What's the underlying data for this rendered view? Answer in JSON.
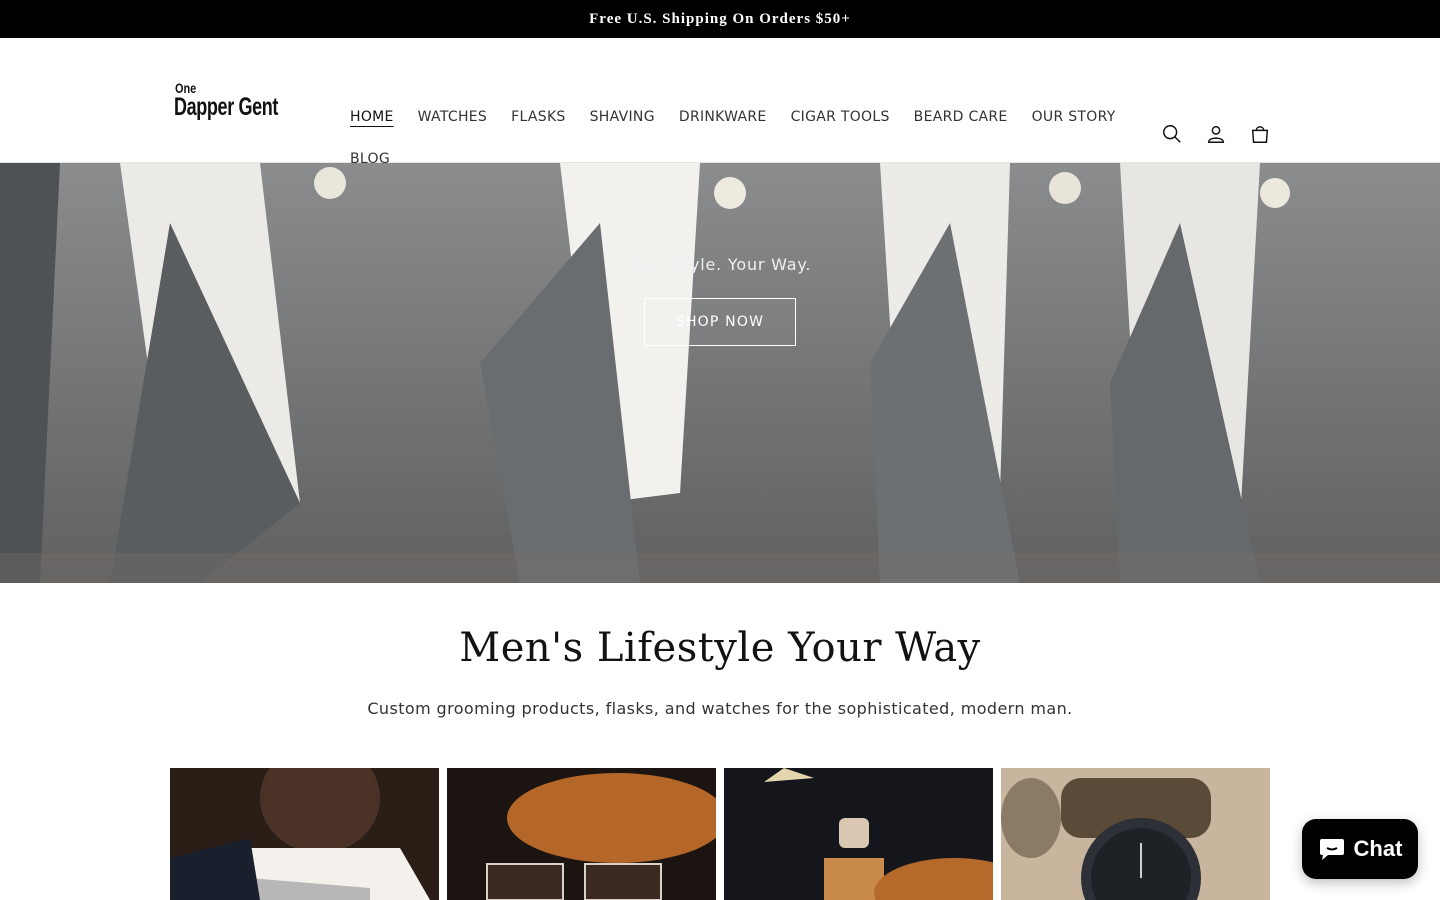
{
  "announcement": {
    "text": "Free U.S. Shipping On Orders $50+"
  },
  "brand": {
    "logo_small": "One",
    "logo_main": "Dapper Gent"
  },
  "nav": {
    "row1": [
      "HOME",
      "WATCHES",
      "FLASKS",
      "SHAVING",
      "DRINKWARE",
      "CIGAR TOOLS",
      "BEARD CARE",
      "OUR STORY"
    ],
    "row2": [
      "BLOG"
    ],
    "active": "HOME"
  },
  "icons": {
    "search": "search-icon",
    "account": "account-icon",
    "cart": "cart-icon"
  },
  "hero": {
    "tagline": "Your Style. Your Way.",
    "cta": "SHOP NOW"
  },
  "intro": {
    "heading": "Men's Lifestyle Your Way",
    "subheading": "Custom grooming products, flasks, and watches for the sophisticated, modern man."
  },
  "chat": {
    "label": "Chat"
  },
  "colors": {
    "announcement_bg": "#000000",
    "hero_bg": "#6f7173",
    "text": "#121212",
    "chat_bg": "#000000"
  }
}
